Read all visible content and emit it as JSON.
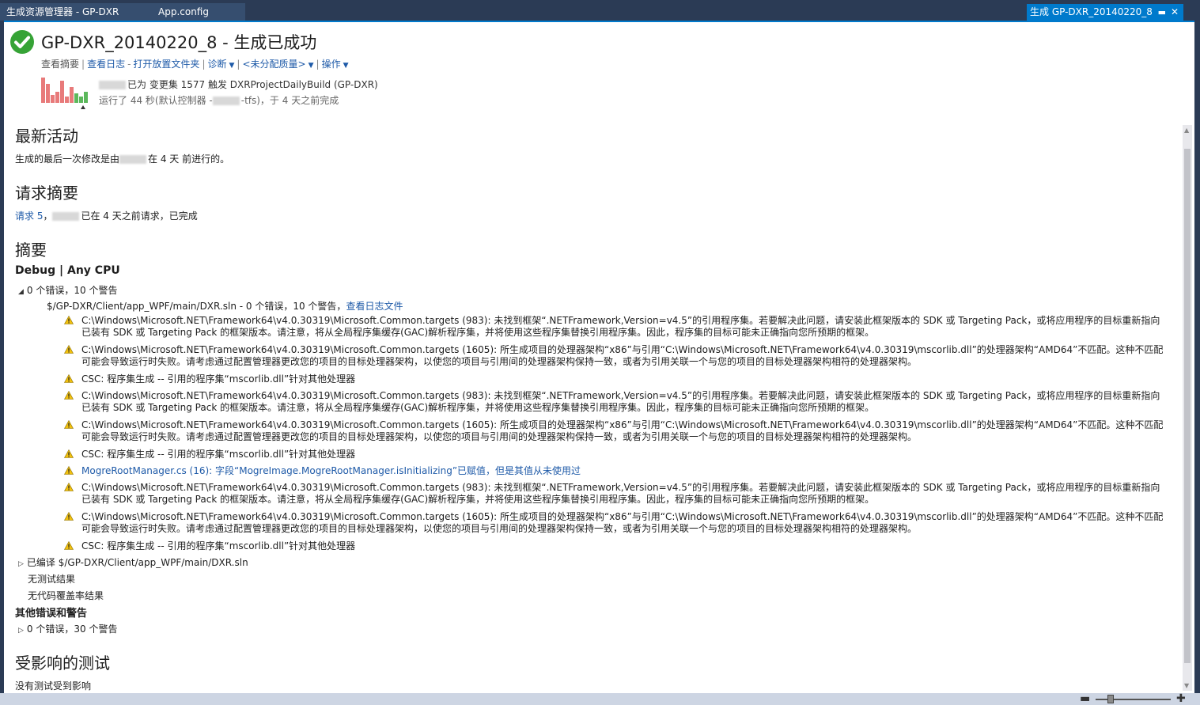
{
  "tabs": {
    "tab1": "生成资源管理器 - GP-DXR",
    "tab2": "App.config",
    "active": "生成 GP-DXR_20140220_8"
  },
  "header": {
    "title": "GP-DXR_20140220_8 - 生成已成功",
    "nav": {
      "summary": "查看摘要",
      "log": "查看日志",
      "open_folder": "打开放置文件夹",
      "diagnose": "诊断",
      "quality": "<未分配质量>",
      "actions": "操作"
    },
    "info_line1": "已为 变更集 1577 触发 DXRProjectDailyBuild (GP-DXR)",
    "info_line2_a": "运行了 44 秒(默认控制器 -",
    "info_line2_b": "-tfs)，于 4 天之前完成"
  },
  "build_history": [
    {
      "height": 32,
      "status": "red"
    },
    {
      "height": 24,
      "status": "red"
    },
    {
      "height": 10,
      "status": "red"
    },
    {
      "height": 14,
      "status": "red"
    },
    {
      "height": 28,
      "status": "red"
    },
    {
      "height": 8,
      "status": "red"
    },
    {
      "height": 20,
      "status": "red"
    },
    {
      "height": 12,
      "status": "green"
    },
    {
      "height": 8,
      "status": "green"
    },
    {
      "height": 14,
      "status": "green"
    }
  ],
  "recent": {
    "heading": "最新活动",
    "text_a": "生成的最后一次修改是由",
    "text_b": "在 4 天 前进行的。"
  },
  "request": {
    "heading": "请求摘要",
    "link": "请求 5",
    "text_a": "，",
    "text_b": "已在 4 天之前请求，已完成"
  },
  "summary": {
    "heading": "摘要",
    "config": "Debug | Any CPU",
    "errors_line": "0 个错误，10 个警告",
    "sln_line": "$/GP-DXR/Client/app_WPF/main/DXR.sln - 0 个错误，10 个警告，",
    "sln_link": "查看日志文件",
    "warnings": [
      {
        "text": "C:\\Windows\\Microsoft.NET\\Framework64\\v4.0.30319\\Microsoft.Common.targets (983): 未找到框架“.NETFramework,Version=v4.5”的引用程序集。若要解决此问题，请安装此框架版本的 SDK 或 Targeting Pack，或将应用程序的目标重新指向已装有 SDK 或 Targeting Pack 的框架版本。请注意，将从全局程序集缓存(GAC)解析程序集，并将使用这些程序集替换引用程序集。因此，程序集的目标可能未正确指向您所预期的框架。",
        "link": false
      },
      {
        "text": "C:\\Windows\\Microsoft.NET\\Framework64\\v4.0.30319\\Microsoft.Common.targets (1605): 所生成项目的处理器架构“x86”与引用“C:\\Windows\\Microsoft.NET\\Framework64\\v4.0.30319\\mscorlib.dll”的处理器架构“AMD64”不匹配。这种不匹配可能会导致运行时失败。请考虑通过配置管理器更改您的项目的目标处理器架构，以使您的项目与引用间的处理器架构保持一致，或者为引用关联一个与您的项目的目标处理器架构相符的处理器架构。",
        "link": false
      },
      {
        "text": "CSC: 程序集生成 -- 引用的程序集“mscorlib.dll”针对其他处理器",
        "link": false
      },
      {
        "text": "C:\\Windows\\Microsoft.NET\\Framework64\\v4.0.30319\\Microsoft.Common.targets (983): 未找到框架“.NETFramework,Version=v4.5”的引用程序集。若要解决此问题，请安装此框架版本的 SDK 或 Targeting Pack，或将应用程序的目标重新指向已装有 SDK 或 Targeting Pack 的框架版本。请注意，将从全局程序集缓存(GAC)解析程序集，并将使用这些程序集替换引用程序集。因此，程序集的目标可能未正确指向您所预期的框架。",
        "link": false
      },
      {
        "text": "C:\\Windows\\Microsoft.NET\\Framework64\\v4.0.30319\\Microsoft.Common.targets (1605): 所生成项目的处理器架构“x86”与引用“C:\\Windows\\Microsoft.NET\\Framework64\\v4.0.30319\\mscorlib.dll”的处理器架构“AMD64”不匹配。这种不匹配可能会导致运行时失败。请考虑通过配置管理器更改您的项目的目标处理器架构，以使您的项目与引用间的处理器架构保持一致，或者为引用关联一个与您的项目的目标处理器架构相符的处理器架构。",
        "link": false
      },
      {
        "text": "CSC: 程序集生成 -- 引用的程序集“mscorlib.dll”针对其他处理器",
        "link": false
      },
      {
        "text": "MogreRootManager.cs (16): 字段“MogreImage.MogreRootManager.isInitializing”已赋值，但是其值从未使用过",
        "link": true
      },
      {
        "text": "C:\\Windows\\Microsoft.NET\\Framework64\\v4.0.30319\\Microsoft.Common.targets (983): 未找到框架“.NETFramework,Version=v4.5”的引用程序集。若要解决此问题，请安装此框架版本的 SDK 或 Targeting Pack，或将应用程序的目标重新指向已装有 SDK 或 Targeting Pack 的框架版本。请注意，将从全局程序集缓存(GAC)解析程序集，并将使用这些程序集替换引用程序集。因此，程序集的目标可能未正确指向您所预期的框架。",
        "link": false
      },
      {
        "text": "C:\\Windows\\Microsoft.NET\\Framework64\\v4.0.30319\\Microsoft.Common.targets (1605): 所生成项目的处理器架构“x86”与引用“C:\\Windows\\Microsoft.NET\\Framework64\\v4.0.30319\\mscorlib.dll”的处理器架构“AMD64”不匹配。这种不匹配可能会导致运行时失败。请考虑通过配置管理器更改您的项目的目标处理器架构，以使您的项目与引用间的处理器架构保持一致，或者为引用关联一个与您的项目的目标处理器架构相符的处理器架构。",
        "link": false
      },
      {
        "text": "CSC: 程序集生成 -- 引用的程序集“mscorlib.dll”针对其他处理器",
        "link": false
      }
    ],
    "compiled": "已编译 $/GP-DXR/Client/app_WPF/main/DXR.sln",
    "no_tests": "无测试结果",
    "no_coverage": "无代码覆盖率结果",
    "other_heading": "其他错误和警告",
    "other_line": "0 个错误，30 个警告"
  },
  "affected": {
    "heading": "受影响的测试",
    "text": "没有测试受到影响"
  },
  "colors": {
    "accent": "#007acc",
    "link": "#1e5aa8",
    "success": "#36a336",
    "warning": "#f2c10e"
  }
}
